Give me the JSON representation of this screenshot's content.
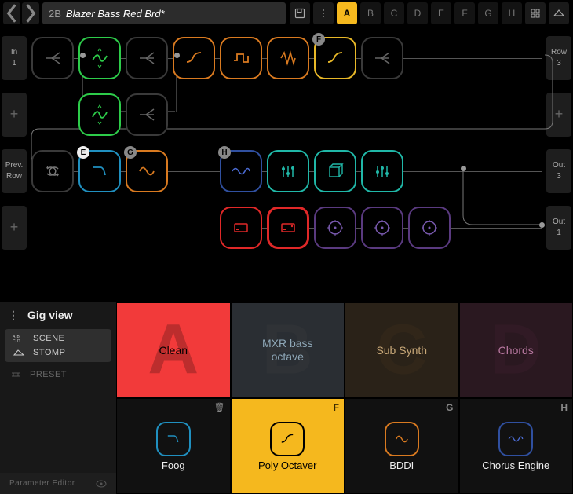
{
  "header": {
    "preset_num": "2B",
    "preset_name": "Blazer Bass Red Brd*",
    "scenes": [
      "A",
      "B",
      "C",
      "D",
      "E",
      "F",
      "G",
      "H"
    ],
    "active_scene": "A"
  },
  "grid": {
    "row1": {
      "left_top": "In",
      "left_bot": "1",
      "right_top": "Row",
      "right_bot": "3",
      "badge_f": "F"
    },
    "row2": {
      "left_plus": "+",
      "right_plus": "+"
    },
    "row3": {
      "left_top": "Prev.",
      "left_bot": "Row",
      "right_top": "Out",
      "right_bot": "3",
      "badge_e": "E",
      "badge_g": "G",
      "badge_h": "H"
    },
    "row4": {
      "left_plus": "+",
      "right_top": "Out",
      "right_bot": "1"
    }
  },
  "gig": {
    "title": "Gig view",
    "scene_label": "SCENE",
    "stomp_label": "STOMP",
    "preset_label": "PRESET",
    "param_label": "Parameter Editor",
    "tiles": {
      "A": {
        "letter": "A",
        "label": "Clean"
      },
      "B": {
        "letter": "B",
        "label": "MXR bass\noctave"
      },
      "C": {
        "letter": "C",
        "label": "Sub Synth"
      },
      "D": {
        "letter": "D",
        "label": "Chords"
      },
      "E": {
        "tag": "",
        "trash": "🗑",
        "label": "Foog"
      },
      "F": {
        "tag": "F",
        "label": "Poly Octaver"
      },
      "G": {
        "tag": "G",
        "label": "BDDI"
      },
      "H": {
        "tag": "H",
        "label": "Chorus Engine"
      }
    }
  }
}
